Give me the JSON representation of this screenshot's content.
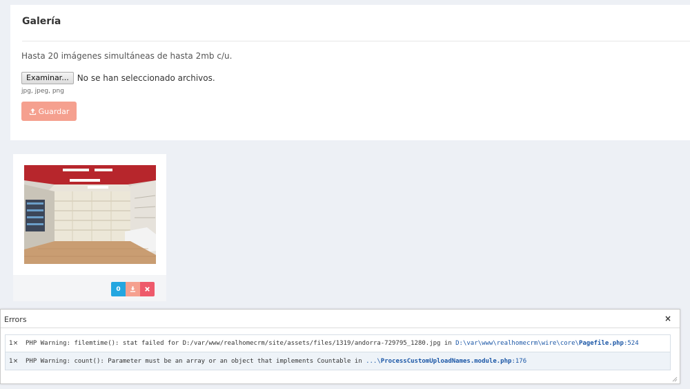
{
  "gallery": {
    "title": "Galería",
    "description": "Hasta 20 imágenes simultáneas de hasta 2mb c/u.",
    "file_button_label": "Examinar...",
    "file_status": "No se han seleccionado archivos.",
    "file_hint": "jpg, jpeg, png",
    "save_label": "Guardar",
    "save_icon": "upload-icon",
    "save_color": "#f5a08f"
  },
  "image_card": {
    "counter": "0",
    "count_color": "#23a6e0",
    "download_color": "#f5a08f",
    "delete_color": "#ee5a6b"
  },
  "errors_panel": {
    "title": "Errors",
    "close_label": "×",
    "rows": [
      {
        "count": "1×",
        "message": "PHP Warning: filemtime(): stat failed for D:/var/www/realhomecrm/site/assets/files/1319/andorra-729795_1280.jpg in ",
        "link_path": "D:\\var\\www\\realhomecrm\\wire\\core\\",
        "link_file": "Pagefile.php",
        "link_line": ":524"
      },
      {
        "count": "1×",
        "message": "PHP Warning: count(): Parameter must be an array or an object that implements Countable in ",
        "link_path": "...\\",
        "link_file": "ProcessCustomUploadNames.module.php",
        "link_line": ":176"
      }
    ]
  }
}
